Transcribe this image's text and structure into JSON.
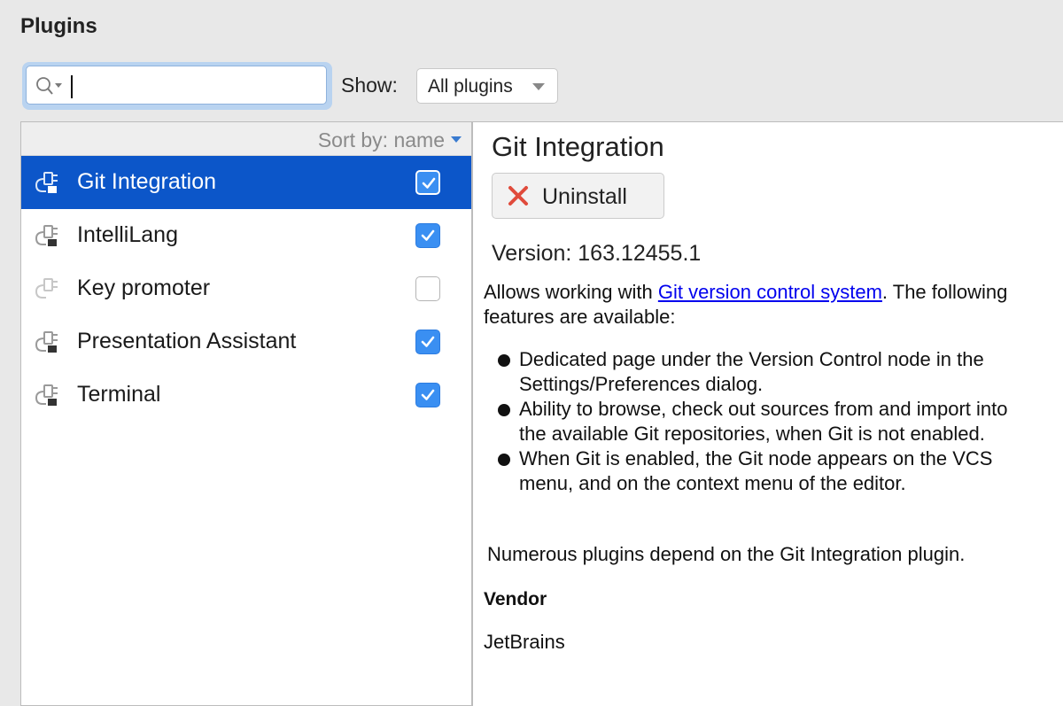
{
  "page": {
    "title": "Plugins"
  },
  "toolbar": {
    "search_value": "",
    "show_label": "Show:",
    "show_selected": "All plugins"
  },
  "list": {
    "sort_label": "Sort by: name",
    "plugins": [
      {
        "name": "Git Integration",
        "enabled": true,
        "selected": true
      },
      {
        "name": "IntelliLang",
        "enabled": true,
        "selected": false
      },
      {
        "name": "Key promoter",
        "enabled": false,
        "selected": false
      },
      {
        "name": "Presentation Assistant",
        "enabled": true,
        "selected": false
      },
      {
        "name": "Terminal",
        "enabled": true,
        "selected": false
      }
    ]
  },
  "detail": {
    "title": "Git Integration",
    "uninstall_label": "Uninstall",
    "version": "Version: 163.12455.1",
    "desc_before": "Allows working with ",
    "desc_link": "Git version control system",
    "desc_after": ". The following features are available:",
    "features": [
      "Dedicated page under the Version Control node in the Settings/Preferences dialog.",
      "Ability to browse, check out sources from and import into the available Git repositories, when Git is not enabled.",
      "When Git is enabled, the Git node appears on the VCS menu, and on the context menu of the editor."
    ],
    "depends": "Numerous plugins depend on the Git Integration plugin.",
    "vendor_label": "Vendor",
    "vendor_name": "JetBrains"
  },
  "colors": {
    "selection": "#0c56c9",
    "checkbox": "#3a8ff2",
    "link": "#0000ee",
    "uninstall_icon": "#e04b3c"
  },
  "icons": {
    "search": "search-icon",
    "plugin": "plugin-icon",
    "uninstall": "close-icon",
    "check": "checkmark-icon"
  }
}
